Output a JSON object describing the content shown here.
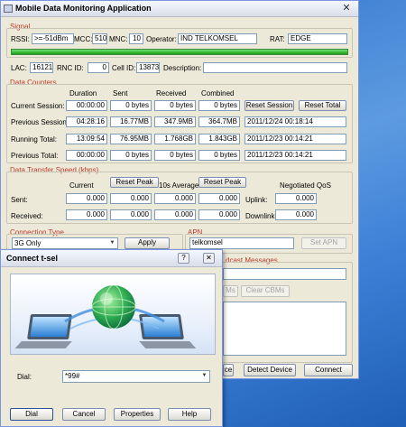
{
  "app": {
    "title": "Mobile Data Monitoring Application",
    "close_glyph": "✕"
  },
  "signal": {
    "section_label": "Signal",
    "rssi_label": "RSSI:",
    "rssi": ">=-51dBm",
    "mcc_label": "MCC:",
    "mcc": "510",
    "mnc_label": "MNC:",
    "mnc": "10",
    "operator_label": "Operator:",
    "operator": "IND TELKOMSEL",
    "rat_label": "RAT:",
    "rat": "EDGE",
    "strength": 1.0,
    "lac_label": "LAC:",
    "lac": "16121",
    "rnc_label": "RNC ID:",
    "rnc": "0",
    "cell_label": "Cell ID:",
    "cell": "13873",
    "desc_label": "Description:",
    "description": ""
  },
  "data_counters": {
    "section_label": "Data Counters",
    "columns": [
      "Duration",
      "Sent",
      "Received",
      "Combined"
    ],
    "rows": [
      {
        "label": "Current Session:",
        "values": [
          "00:00:00",
          "0 bytes",
          "0 bytes",
          "0 bytes"
        ]
      },
      {
        "label": "Previous Session:",
        "values": [
          "04:28:16",
          "16.77MB",
          "347.9MB",
          "364.7MB"
        ],
        "timestamp": "2011/12/24 00:18:14"
      },
      {
        "label": "Running Total:",
        "values": [
          "13:09:54",
          "76.95MB",
          "1.768GB",
          "1.843GB"
        ],
        "timestamp": "2011/12/23 00:14:21"
      },
      {
        "label": "Previous Total:",
        "values": [
          "00:00:00",
          "0 bytes",
          "0 bytes",
          "0 bytes"
        ],
        "timestamp": "2011/12/23 00:14:21"
      }
    ],
    "reset_session": "Reset Session",
    "reset_total": "Reset Total"
  },
  "speed": {
    "section_label": "Data Transfer Speed (kbps)",
    "current_label": "Current",
    "average_label": "10s Average",
    "negotiated_label": "Negotiated QoS",
    "reset_peak": "Reset Peak",
    "sent_label": "Sent:",
    "received_label": "Received:",
    "uplink_label": "Uplink:",
    "downlink_label": "Downlink:",
    "sent": [
      "0.000",
      "0.000",
      "0.000",
      "0.000"
    ],
    "received": [
      "0.000",
      "0.000",
      "0.000",
      "0.000"
    ],
    "uplink": "0.000",
    "downlink": "0.000"
  },
  "connection": {
    "section_label": "Connection Type",
    "selected": "3G Only",
    "apply": "Apply",
    "apn_label": "APN",
    "apn": "telkomsel",
    "set_apn": "Set APN"
  },
  "broadcast": {
    "section_label": "dcast Messages",
    "cbm_btn": "Ms",
    "clear": "Clear CBMs"
  },
  "bottom": {
    "service": "ce",
    "detect": "Detect Device",
    "connect": "Connect"
  },
  "dialog": {
    "title": "Connect t-sel",
    "help_glyph": "?",
    "close_glyph": "✕",
    "dial_label": "Dial:",
    "dial_value": "*99#",
    "buttons": {
      "dial": "Dial",
      "cancel": "Cancel",
      "properties": "Properties",
      "help": "Help"
    }
  }
}
